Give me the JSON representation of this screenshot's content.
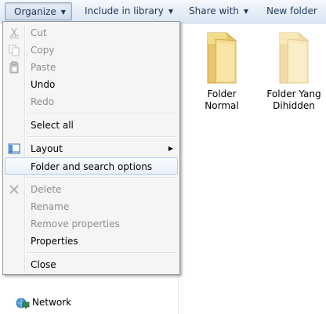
{
  "toolbar": {
    "organize": "Organize",
    "include_in_library": "Include in library",
    "share_with": "Share with",
    "new_folder": "New folder"
  },
  "menu": {
    "cut": "Cut",
    "copy": "Copy",
    "paste": "Paste",
    "undo": "Undo",
    "redo": "Redo",
    "select_all": "Select all",
    "layout": "Layout",
    "folder_and_search_options": "Folder and search options",
    "delete": "Delete",
    "rename": "Rename",
    "remove_properties": "Remove properties",
    "properties": "Properties",
    "close": "Close"
  },
  "nav": {
    "network": "Network"
  },
  "folders": [
    {
      "line1": "Folder",
      "line2": "Normal",
      "hidden": false
    },
    {
      "line1": "Folder Yang",
      "line2": "Dihidden",
      "hidden": true
    }
  ],
  "icons": {
    "organize_arrow": "chevron-down-icon",
    "cut": "scissors-icon",
    "copy": "copy-icon",
    "paste": "paste-icon",
    "layout": "layout-icon",
    "delete": "delete-x-icon",
    "network": "network-icon",
    "folder": "folder-icon"
  },
  "colors": {
    "toolbar_text": "#1e395b",
    "disabled_text": "#8d8d8d",
    "hover_border": "#aecff7"
  }
}
